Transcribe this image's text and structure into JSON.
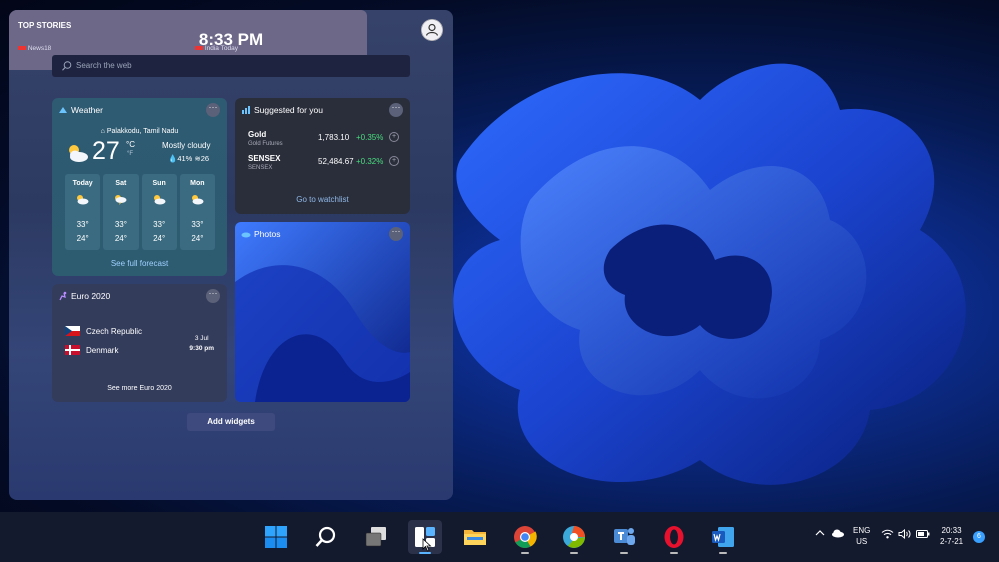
{
  "widgets_panel": {
    "clock": "8:33 PM",
    "search_placeholder": "Search the web"
  },
  "weather": {
    "title": "Weather",
    "location": "Palakkodu, Tamil Nadu",
    "temp": "27",
    "unit_c": "°C",
    "unit_f": "°F",
    "condition": "Mostly cloudy",
    "humidity": "41%",
    "wind": "26",
    "forecast": [
      {
        "day": "Today",
        "hi": "33°",
        "lo": "24°"
      },
      {
        "day": "Sat",
        "hi": "33°",
        "lo": "24°"
      },
      {
        "day": "Sun",
        "hi": "33°",
        "lo": "24°"
      },
      {
        "day": "Mon",
        "hi": "33°",
        "lo": "24°"
      }
    ],
    "link": "See full forecast"
  },
  "suggested": {
    "title": "Suggested for you",
    "stocks": [
      {
        "name": "Gold",
        "sub": "Gold Futures",
        "price": "1,783.10",
        "change": "+0.35%"
      },
      {
        "name": "SENSEX",
        "sub": "SENSEX",
        "price": "52,484.67",
        "change": "+0.32%"
      }
    ],
    "link": "Go to watchlist"
  },
  "photos": {
    "title": "Photos"
  },
  "euro": {
    "title": "Euro 2020",
    "team1": "Czech Republic",
    "team2": "Denmark",
    "date": "3 Jul",
    "time": "9:30 pm",
    "link": "See more Euro 2020"
  },
  "add_widgets": "Add widgets",
  "top_stories": {
    "title": "TOP STORIES",
    "source1": "News18",
    "source2": "India Today"
  },
  "tray": {
    "lang": "ENG",
    "region": "US",
    "time": "20:33",
    "date": "2-7-21",
    "badge": "6"
  },
  "colors": {
    "accent": "#0078d4",
    "positive": "#4ade80",
    "link": "#9fd0ff"
  }
}
